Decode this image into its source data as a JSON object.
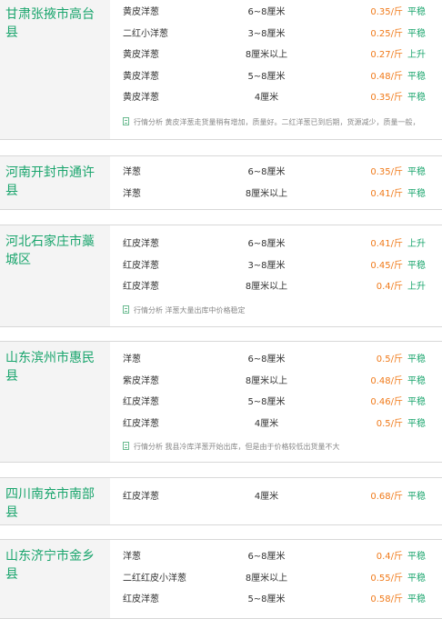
{
  "blocks": [
    {
      "region": "甘肃张掖市高台县",
      "rows": [
        {
          "name": "黄皮洋葱",
          "spec": "6~8厘米",
          "price": "0.35/斤",
          "trend": "平稳"
        },
        {
          "name": "二红小洋葱",
          "spec": "3~8厘米",
          "price": "0.25/斤",
          "trend": "平稳"
        },
        {
          "name": "黄皮洋葱",
          "spec": "8厘米以上",
          "price": "0.27/斤",
          "trend": "上升"
        },
        {
          "name": "黄皮洋葱",
          "spec": "5~8厘米",
          "price": "0.48/斤",
          "trend": "平稳"
        },
        {
          "name": "黄皮洋葱",
          "spec": "4厘米",
          "price": "0.35/斤",
          "trend": "平稳"
        }
      ],
      "note": "行情分析 黄皮洋葱走货量稍有增加，质量好。二红洋葱已到后期，货源减少，质量一般，"
    },
    {
      "region": "河南开封市通许县",
      "rows": [
        {
          "name": "洋葱",
          "spec": "6~8厘米",
          "price": "0.35/斤",
          "trend": "平稳"
        },
        {
          "name": "洋葱",
          "spec": "8厘米以上",
          "price": "0.41/斤",
          "trend": "平稳"
        }
      ],
      "note": ""
    },
    {
      "region": "河北石家庄市藁城区",
      "rows": [
        {
          "name": "红皮洋葱",
          "spec": "6~8厘米",
          "price": "0.41/斤",
          "trend": "上升"
        },
        {
          "name": "红皮洋葱",
          "spec": "3~8厘米",
          "price": "0.45/斤",
          "trend": "平稳"
        },
        {
          "name": "红皮洋葱",
          "spec": "8厘米以上",
          "price": "0.4/斤",
          "trend": "上升"
        }
      ],
      "note": "行情分析 洋葱大量出库中价格稳定"
    },
    {
      "region": "山东滨州市惠民县",
      "rows": [
        {
          "name": "洋葱",
          "spec": "6~8厘米",
          "price": "0.5/斤",
          "trend": "平稳"
        },
        {
          "name": "紫皮洋葱",
          "spec": "8厘米以上",
          "price": "0.48/斤",
          "trend": "平稳"
        },
        {
          "name": "红皮洋葱",
          "spec": "5~8厘米",
          "price": "0.46/斤",
          "trend": "平稳"
        },
        {
          "name": "红皮洋葱",
          "spec": "4厘米",
          "price": "0.5/斤",
          "trend": "平稳"
        }
      ],
      "note": "行情分析 我县冷库洋葱开始出库，但是由于价格较低出货量不大"
    },
    {
      "region": "四川南充市南部县",
      "rows": [
        {
          "name": "红皮洋葱",
          "spec": "4厘米",
          "price": "0.68/斤",
          "trend": "平稳"
        }
      ],
      "note": ""
    },
    {
      "region": "山东济宁市金乡县",
      "rows": [
        {
          "name": "洋葱",
          "spec": "6~8厘米",
          "price": "0.4/斤",
          "trend": "平稳"
        },
        {
          "name": "二红红皮小洋葱",
          "spec": "8厘米以上",
          "price": "0.55/斤",
          "trend": "平稳"
        },
        {
          "name": "红皮洋葱",
          "spec": "5~8厘米",
          "price": "0.58/斤",
          "trend": "平稳"
        }
      ],
      "note": ""
    }
  ],
  "colors": {
    "region": "#1aa56d",
    "price": "#f07a1a",
    "trend": "#1aa56d",
    "note": "#888888"
  }
}
